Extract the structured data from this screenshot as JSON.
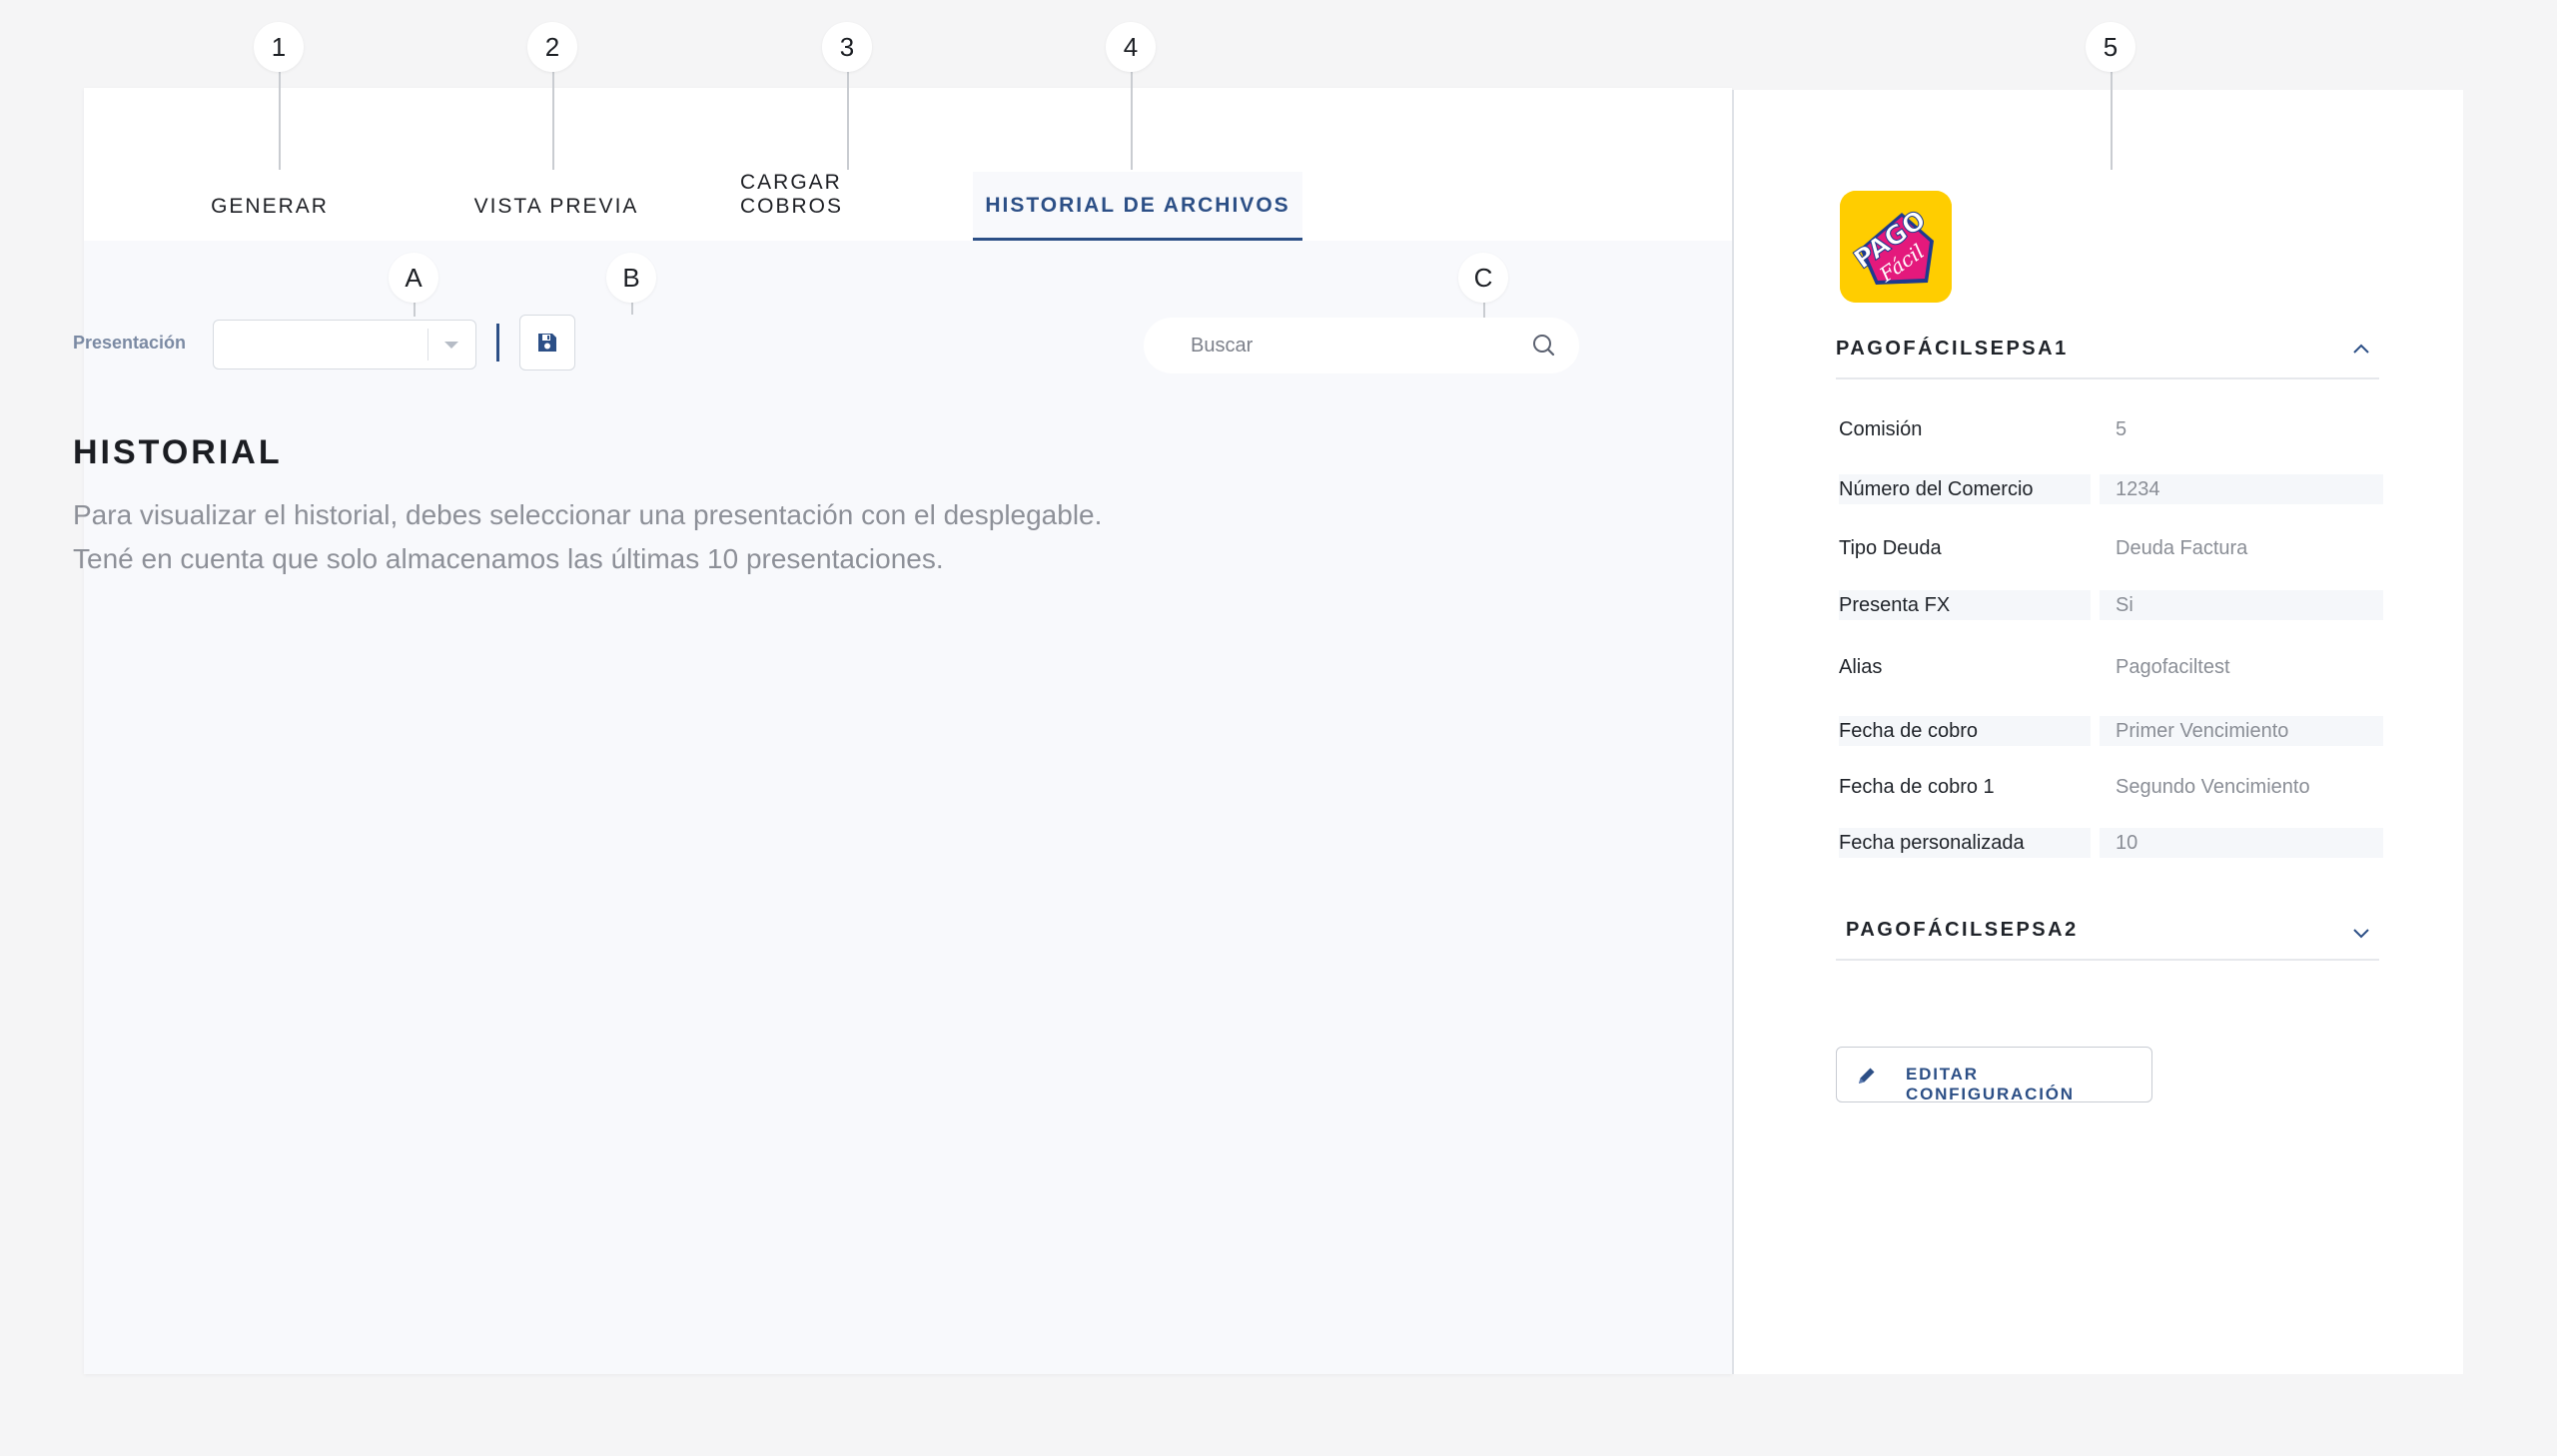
{
  "annotations": {
    "tab_markers": [
      "1",
      "2",
      "3",
      "4",
      "5"
    ],
    "control_markers": [
      "A",
      "B",
      "C"
    ]
  },
  "tabs": [
    {
      "label": "GENERAR",
      "active": false
    },
    {
      "label": "VISTA PREVIA",
      "active": false
    },
    {
      "label": "CARGAR COBROS",
      "active": false
    },
    {
      "label": "HISTORIAL DE ARCHIVOS",
      "active": true
    }
  ],
  "filters": {
    "presentation_label": "Presentación",
    "presentation_value": "",
    "search_placeholder": "Buscar"
  },
  "history": {
    "title": "HISTORIAL",
    "line1": "Para visualizar el historial, debes seleccionar una presentación con el desplegable.",
    "line2": "Tené en cuenta que solo almacenamos las últimas 10 presentaciones."
  },
  "sidebar": {
    "logo_text_top": "PAGO",
    "logo_text_bottom": "Fácil",
    "section1_title": "PAGOFÁCILSEPSA1",
    "section2_title": "PAGOFÁCILSEPSA2",
    "fields": [
      {
        "label": "Comisión",
        "value": "5"
      },
      {
        "label": "Número del Comercio",
        "value": "1234"
      },
      {
        "label": "Tipo Deuda",
        "value": "Deuda Factura"
      },
      {
        "label": "Presenta FX",
        "value": "Si"
      },
      {
        "label": "Alias",
        "value": "Pagofaciltest"
      },
      {
        "label": "Fecha de cobro",
        "value": "Primer Vencimiento"
      },
      {
        "label": "Fecha de cobro 1",
        "value": "Segundo Vencimiento"
      },
      {
        "label": "Fecha personalizada",
        "value": "10"
      }
    ],
    "edit_button": "EDITAR CONFIGURACIÓN"
  },
  "colors": {
    "accent": "#2c4f86",
    "logo_bg": "#ffcd00",
    "logo_pink": "#e4197c",
    "logo_blue": "#1d3a8f"
  }
}
